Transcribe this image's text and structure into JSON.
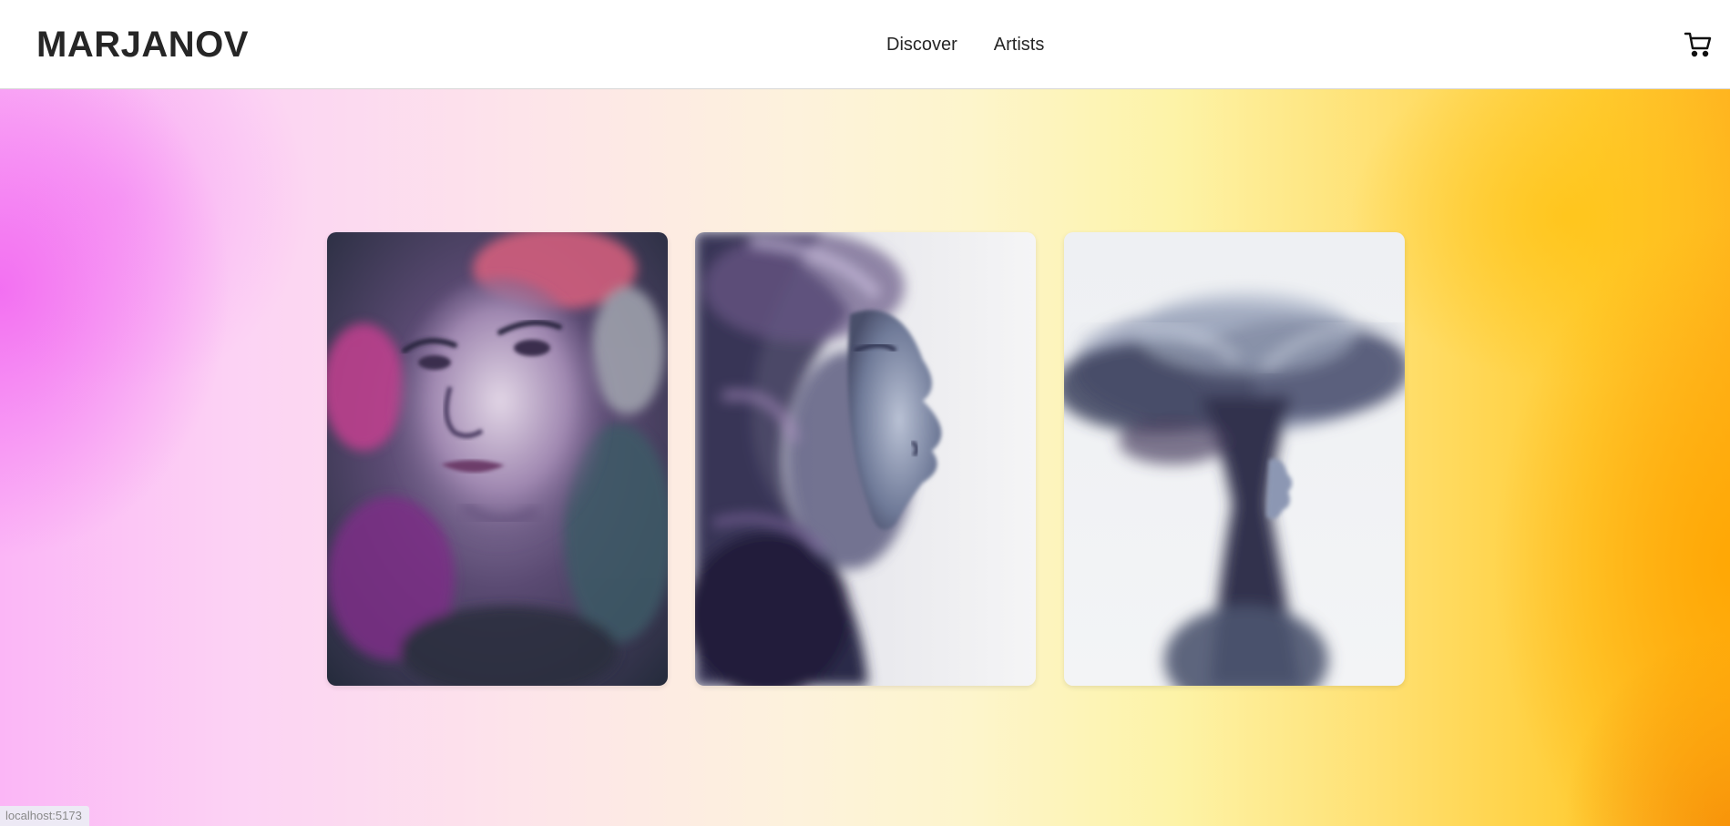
{
  "header": {
    "logo": "MARJANOV",
    "nav": [
      {
        "label": "Discover"
      },
      {
        "label": "Artists"
      }
    ],
    "cart_icon": "shopping-cart-icon"
  },
  "gallery": {
    "artworks": [
      {
        "image": "portrait-face-purple-painting"
      },
      {
        "image": "profile-face-flowing-hair-painting"
      },
      {
        "image": "figure-smoky-hair-painting"
      }
    ]
  },
  "status_bar": {
    "url": "localhost:5173"
  },
  "colors": {
    "text": "#262626",
    "background_left": "#f26af0",
    "background_right": "#ffb51f"
  }
}
